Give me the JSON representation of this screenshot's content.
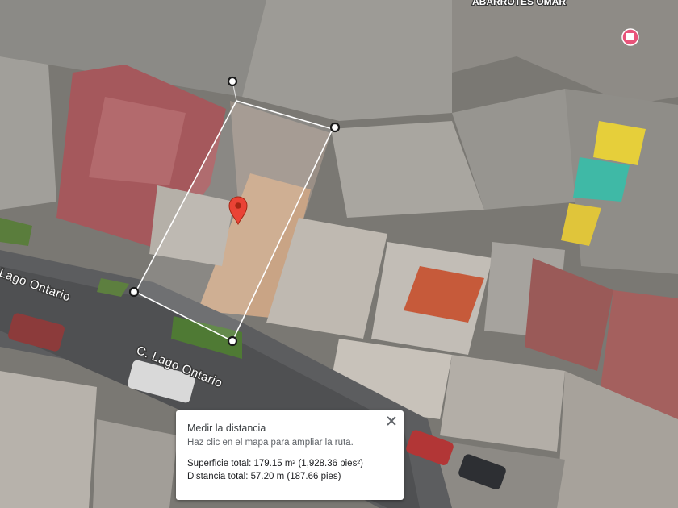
{
  "map": {
    "streets": [
      {
        "id": "street-lago-ontario-left",
        "label": "Lago Ontario"
      },
      {
        "id": "street-lago-ontario-main",
        "label": "C. Lago Ontario"
      }
    ],
    "poi": {
      "label": "ABARROTES OMAR",
      "icon": "store-icon",
      "color": "#e8547a"
    },
    "marker": {
      "icon": "location-pin-icon",
      "color": "#ea4335"
    },
    "measurement": {
      "line_color": "#ffffff",
      "fill": "rgba(255,255,255,0.12)",
      "vertex_icon": "vertex-dot-icon"
    }
  },
  "panel": {
    "title": "Medir la distancia",
    "hint": "Haz clic en el mapa para ampliar la ruta.",
    "area_label": "Superficie total:",
    "area_value": "179.15 m² (1,928.36 pies²)",
    "distance_label": "Distancia total:",
    "distance_value": "57.20 m (187.66 pies)",
    "close_icon": "close-icon"
  }
}
